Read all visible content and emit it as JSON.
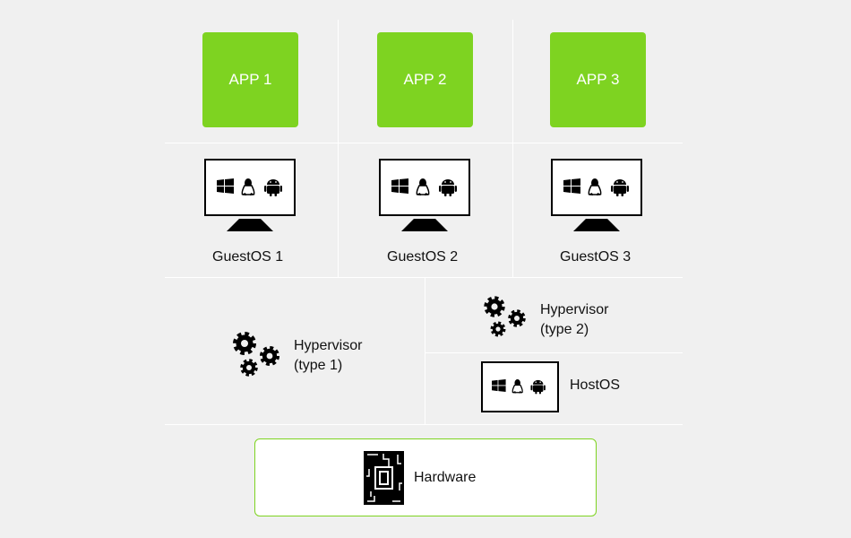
{
  "colors": {
    "app": "#7ed321",
    "hardware_border": "#7ed321",
    "background": "#f0f0f0"
  },
  "apps": [
    {
      "label": "APP 1"
    },
    {
      "label": "APP 2"
    },
    {
      "label": "APP 3"
    }
  ],
  "guests": [
    {
      "label": "GuestOS 1"
    },
    {
      "label": "GuestOS 2"
    },
    {
      "label": "GuestOS 3"
    }
  ],
  "hypervisor1": {
    "line1": "Hypervisor",
    "line2": "(type 1)"
  },
  "hypervisor2": {
    "line1": "Hypervisor",
    "line2": "(type 2)"
  },
  "host": {
    "label": "HostOS"
  },
  "hardware": {
    "label": "Hardware"
  },
  "icons": [
    "windows-icon",
    "linux-icon",
    "android-icon",
    "gears-icon",
    "chip-icon"
  ]
}
